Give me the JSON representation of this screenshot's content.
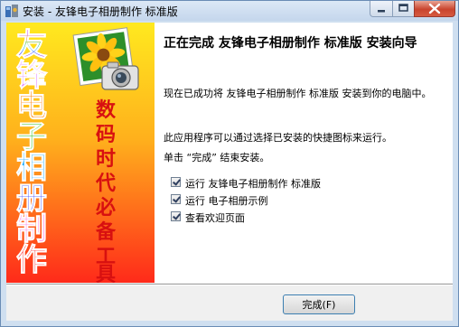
{
  "window": {
    "title": "安装 - 友锋电子相册制作 标准版"
  },
  "banner": {
    "title_chars": [
      "友",
      "锋",
      "电",
      "子",
      "相",
      "册",
      "制",
      "作"
    ],
    "subtitle_chars": [
      "数",
      "码",
      "时",
      "代",
      "必",
      "备",
      "工",
      "具"
    ]
  },
  "content": {
    "heading": "正在完成 友锋电子相册制作 标准版 安装向导",
    "p1": "现在已成功将 友锋电子相册制作 标准版 安装到你的电脑中。",
    "p2": "此应用程序可以通过选择已安装的快捷图标来运行。",
    "p3": "单击 “完成” 结束安装。",
    "options": [
      {
        "label": "运行 友锋电子相册制作 标准版",
        "checked": true
      },
      {
        "label": "运行 电子相册示例",
        "checked": true
      },
      {
        "label": "查看欢迎页面",
        "checked": true
      }
    ]
  },
  "footer": {
    "finish_label": "完成(F)"
  },
  "colors": {
    "banner_top": "#ffeb2a",
    "banner_bottom": "#ff2a1a",
    "subtitle": "#d81010",
    "close_button": "#c9442e"
  }
}
